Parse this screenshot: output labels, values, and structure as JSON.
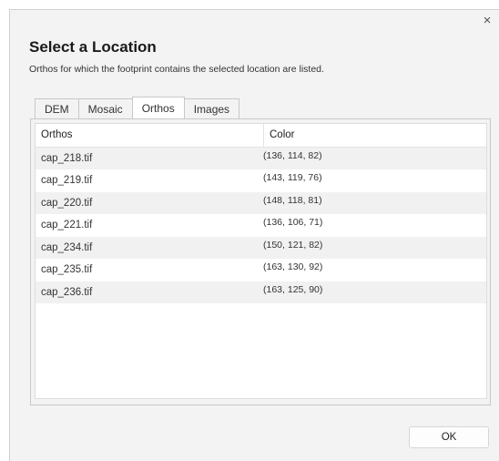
{
  "dialog": {
    "close_glyph": "×",
    "title": "Select a Location",
    "subtitle": "Orthos for which the footprint contains the selected location are listed."
  },
  "tabs": [
    {
      "label": "DEM",
      "active": false
    },
    {
      "label": "Mosaic",
      "active": false
    },
    {
      "label": "Orthos",
      "active": true
    },
    {
      "label": "Images",
      "active": false
    }
  ],
  "table": {
    "columns": [
      "Orthos",
      "Color"
    ],
    "rows": [
      {
        "name": "cap_218.tif",
        "color": "(136, 114, 82)"
      },
      {
        "name": "cap_219.tif",
        "color": "(143, 119, 76)"
      },
      {
        "name": "cap_220.tif",
        "color": "(148, 118, 81)"
      },
      {
        "name": "cap_221.tif",
        "color": "(136, 106, 71)"
      },
      {
        "name": "cap_234.tif",
        "color": "(150, 121, 82)"
      },
      {
        "name": "cap_235.tif",
        "color": "(163, 130, 92)"
      },
      {
        "name": "cap_236.tif",
        "color": "(163, 125, 90)"
      }
    ]
  },
  "buttons": {
    "ok_label": "OK"
  }
}
